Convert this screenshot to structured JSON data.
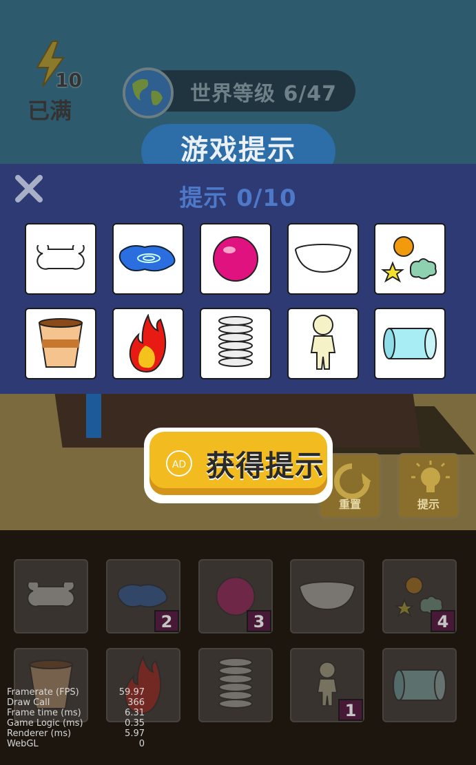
{
  "hud": {
    "energy_count": "10",
    "energy_status": "已满",
    "world_level_label": "世界等级 6/47",
    "game_hint_button": "游戏提示"
  },
  "hint_panel": {
    "title": "提示 0/10",
    "close_icon": "close-icon",
    "items": [
      {
        "icon": "bone-icon"
      },
      {
        "icon": "water-puddle-icon"
      },
      {
        "icon": "pink-ball-icon"
      },
      {
        "icon": "bowl-icon"
      },
      {
        "icon": "star-cloud-orb-icon"
      },
      {
        "icon": "cup-icon"
      },
      {
        "icon": "fire-icon"
      },
      {
        "icon": "spring-icon"
      },
      {
        "icon": "figure-icon"
      },
      {
        "icon": "glass-tube-icon"
      }
    ]
  },
  "ad_button": {
    "badge": "AD",
    "label": "获得提示"
  },
  "tools": {
    "reset_label": "重置",
    "hint_label": "提示"
  },
  "inventory": [
    {
      "icon": "bone-icon",
      "count": ""
    },
    {
      "icon": "water-puddle-icon",
      "count": "2"
    },
    {
      "icon": "pink-ball-icon",
      "count": "3"
    },
    {
      "icon": "bowl-icon",
      "count": ""
    },
    {
      "icon": "star-cloud-orb-icon",
      "count": "4"
    },
    {
      "icon": "cup-icon",
      "count": ""
    },
    {
      "icon": "fire-icon",
      "count": ""
    },
    {
      "icon": "spring-icon",
      "count": ""
    },
    {
      "icon": "figure-icon",
      "count": "1"
    },
    {
      "icon": "glass-tube-icon",
      "count": ""
    }
  ],
  "stats": [
    {
      "label": "Framerate (FPS)",
      "value": "59.97"
    },
    {
      "label": "Draw Call",
      "value": "366"
    },
    {
      "label": "Frame time (ms)",
      "value": "6.31"
    },
    {
      "label": "Game Logic (ms)",
      "value": "0.35"
    },
    {
      "label": "Renderer (ms)",
      "value": "5.97"
    },
    {
      "label": "WebGL",
      "value": "0"
    }
  ],
  "colors": {
    "panel": "#2e3a74",
    "ad_button": "#f2bb1f",
    "title_blue": "#4e78c8",
    "badge": "#4a1a3a"
  }
}
